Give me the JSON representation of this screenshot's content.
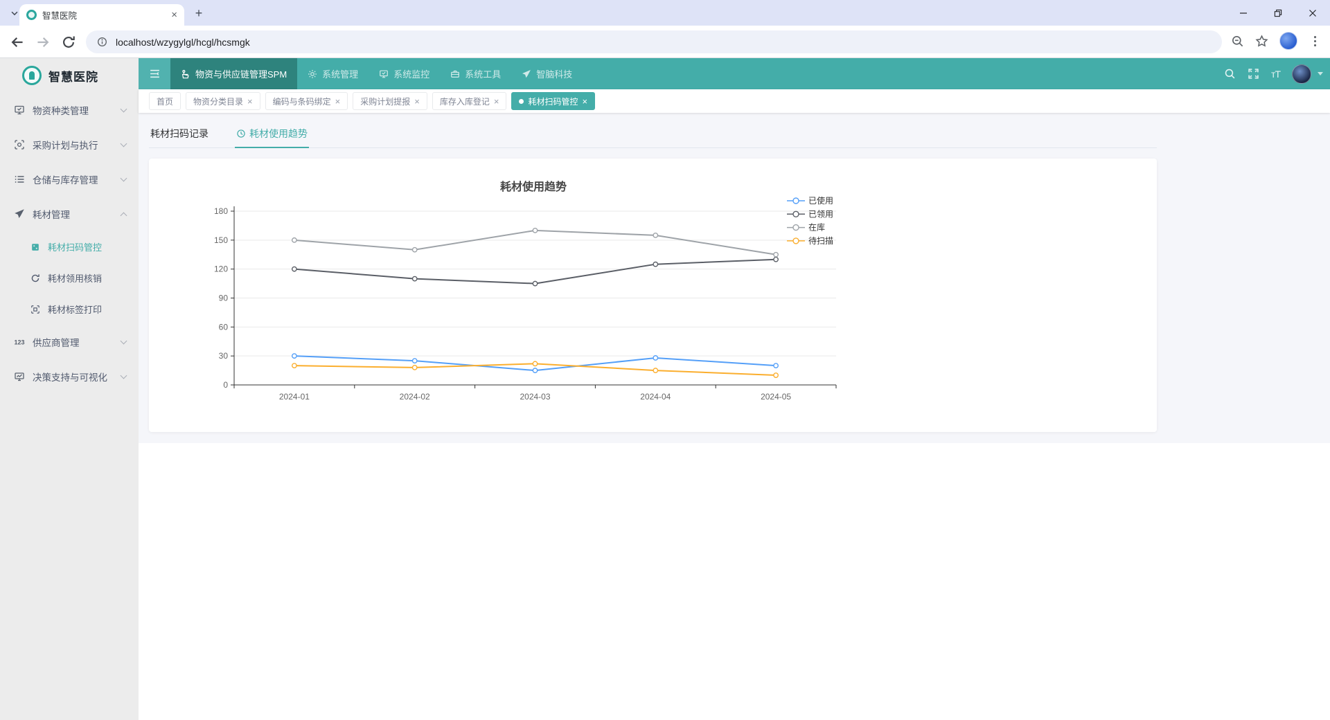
{
  "browser": {
    "tab_title": "智慧医院",
    "new_tab_label": "+",
    "url": "localhost/wzygylgl/hcgl/hcsmgk"
  },
  "sidebar": {
    "logo_text": "智慧医院",
    "items": [
      {
        "label": "物资种类管理",
        "icon": "monitor-check-icon",
        "expanded": false
      },
      {
        "label": "采购计划与执行",
        "icon": "doc-scan-icon",
        "expanded": false
      },
      {
        "label": "仓储与库存管理",
        "icon": "list-icon",
        "expanded": false
      },
      {
        "label": "耗材管理",
        "icon": "paper-plane-icon",
        "expanded": true,
        "children": [
          {
            "label": "耗材扫码管控",
            "icon": "qr-icon",
            "active": true
          },
          {
            "label": "耗材领用核销",
            "icon": "refresh-icon",
            "active": false
          },
          {
            "label": "耗材标签打印",
            "icon": "label-scan-icon",
            "active": false
          }
        ]
      },
      {
        "label": "供应商管理",
        "icon": "numbers-icon",
        "expanded": false
      },
      {
        "label": "决策支持与可视化",
        "icon": "dashboard-icon",
        "expanded": false
      }
    ]
  },
  "topnav": {
    "items": [
      {
        "label": "物资与供应链管理SPM",
        "icon": "package-icon",
        "active": true
      },
      {
        "label": "系统管理",
        "icon": "gear-icon",
        "active": false
      },
      {
        "label": "系统监控",
        "icon": "monitor-icon",
        "active": false
      },
      {
        "label": "系统工具",
        "icon": "toolbox-icon",
        "active": false
      },
      {
        "label": "智脑科技",
        "icon": "paper-plane-icon",
        "active": false
      }
    ]
  },
  "tabs_bar": {
    "chips": [
      {
        "label": "首页",
        "closable": false,
        "active": false
      },
      {
        "label": "物资分类目录",
        "closable": true,
        "active": false
      },
      {
        "label": "编码与条码绑定",
        "closable": true,
        "active": false
      },
      {
        "label": "采购计划提报",
        "closable": true,
        "active": false
      },
      {
        "label": "库存入库登记",
        "closable": true,
        "active": false
      },
      {
        "label": "耗材扫码管控",
        "closable": true,
        "active": true
      }
    ]
  },
  "subtabs": [
    {
      "label": "耗材扫码记录",
      "active": false
    },
    {
      "label": "耗材使用趋势",
      "active": true,
      "icon": "clock-icon"
    }
  ],
  "colors": {
    "teal": "#44ada9",
    "teal_dark": "#2e837d",
    "series_blue": "#549FF8",
    "series_darkgray": "#5A5E66",
    "series_gray": "#9EA3A8",
    "series_orange": "#FBAE2E"
  },
  "chart_data": {
    "type": "line",
    "title": "耗材使用趋势",
    "categories": [
      "2024-01",
      "2024-02",
      "2024-03",
      "2024-04",
      "2024-05"
    ],
    "series": [
      {
        "name": "已使用",
        "color": "#549FF8",
        "values": [
          30,
          25,
          15,
          28,
          20
        ]
      },
      {
        "name": "已领用",
        "color": "#5A5E66",
        "values": [
          120,
          110,
          105,
          125,
          130
        ]
      },
      {
        "name": "在库",
        "color": "#9EA3A8",
        "values": [
          150,
          140,
          160,
          155,
          135
        ]
      },
      {
        "name": "待扫描",
        "color": "#FBAE2E",
        "values": [
          20,
          18,
          22,
          15,
          10
        ]
      }
    ],
    "xlabel": "",
    "ylabel": "",
    "ylim": [
      0,
      180
    ],
    "y_interval": 30,
    "grid": true,
    "legend_position": "top-right",
    "marker": "hollow-circle"
  }
}
